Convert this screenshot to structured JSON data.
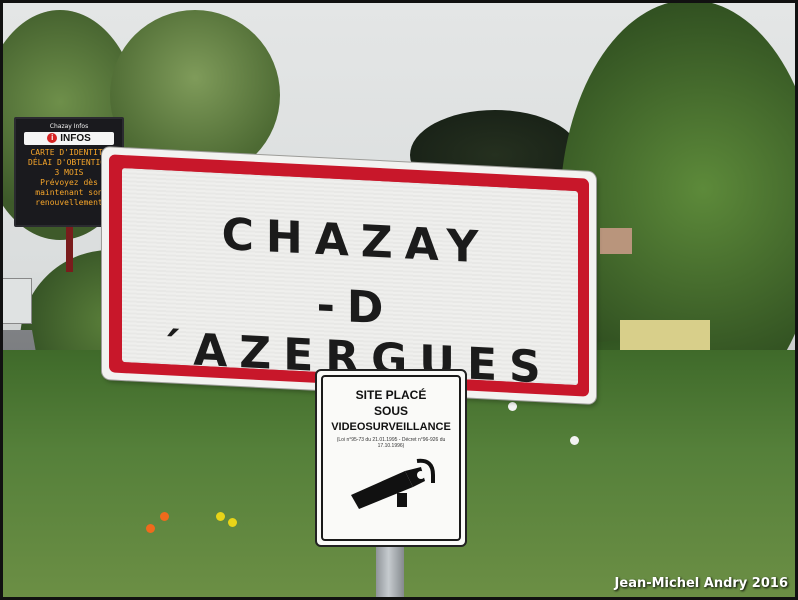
{
  "info_board": {
    "header": "Chazay Infos",
    "title": "INFOS",
    "lines": [
      "CARTE D'IDENTITE",
      "DÉLAI D'OBTENTION",
      "3 MOIS",
      "Prévoyez dès",
      "maintenant son",
      "renouvellement"
    ]
  },
  "town_sign": {
    "line1": "CHAZAY",
    "line2": "-D´AZERGUES",
    "border_color": "#c8172a"
  },
  "surveillance_sign": {
    "line1": "SITE PLACÉ",
    "line2": "SOUS",
    "line3": "VIDEOSURVEILLANCE",
    "legal": "(Loi n°95-73 du 21.01.1995 - Décret n°96-926 du 17.10.1996)",
    "icon": "camera-icon"
  },
  "credit": "Jean-Michel Andry 2016"
}
